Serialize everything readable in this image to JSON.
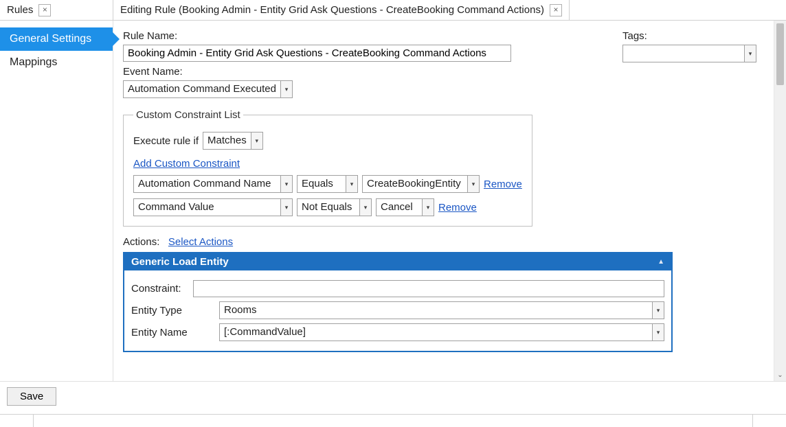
{
  "tabs": {
    "rules": "Rules",
    "editing": "Editing Rule (Booking Admin - Entity Grid Ask Questions - CreateBooking Command Actions)"
  },
  "sidebar": {
    "items": [
      {
        "label": "General Settings",
        "active": true
      },
      {
        "label": "Mappings",
        "active": false
      }
    ]
  },
  "form": {
    "ruleNameLabel": "Rule Name:",
    "ruleName": "Booking Admin - Entity Grid Ask Questions - CreateBooking Command Actions",
    "eventNameLabel": "Event Name:",
    "eventName": "Automation Command Executed",
    "tagsLabel": "Tags:",
    "tagsValue": ""
  },
  "constraints": {
    "legend": "Custom Constraint List",
    "executeLabel": "Execute rule if",
    "executeMode": "Matches",
    "addLink": "Add Custom Constraint",
    "rows": [
      {
        "field": "Automation Command Name",
        "op": "Equals",
        "value": "CreateBookingEntity",
        "remove": "Remove"
      },
      {
        "field": "Command Value",
        "op": "Not Equals",
        "value": "Cancel",
        "remove": "Remove"
      }
    ]
  },
  "actions": {
    "label": "Actions:",
    "selectLink": "Select Actions",
    "panelTitle": "Generic Load Entity",
    "fields": {
      "constraintLabel": "Constraint:",
      "constraintValue": "",
      "entityTypeLabel": "Entity Type",
      "entityTypeValue": "Rooms",
      "entityNameLabel": "Entity Name",
      "entityNameValue": "[:CommandValue]"
    }
  },
  "buttons": {
    "save": "Save"
  }
}
